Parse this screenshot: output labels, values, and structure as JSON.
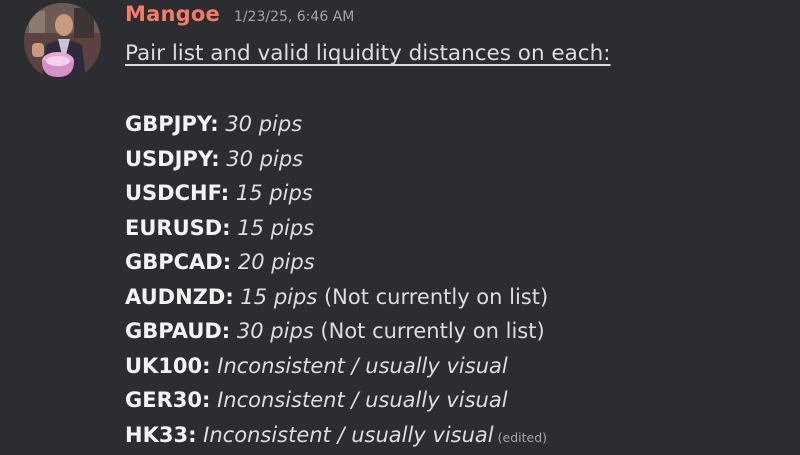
{
  "message": {
    "author": "Mangoe",
    "timestamp": "1/23/25, 6:46 AM",
    "intro": "Pair list and valid liquidity distances on each:",
    "edited_label": "(edited)",
    "rows": [
      {
        "pair": "GBPJPY:",
        "value": "30 pips",
        "note": ""
      },
      {
        "pair": "USDJPY:",
        "value": "30 pips",
        "note": ""
      },
      {
        "pair": "USDCHF:",
        "value": "15 pips",
        "note": ""
      },
      {
        "pair": "EURUSD:",
        "value": "15 pips",
        "note": ""
      },
      {
        "pair": "GBPCAD:",
        "value": "20 pips",
        "note": ""
      },
      {
        "pair": "AUDNZD:",
        "value": "15 pips",
        "note": "(Not currently on list)"
      },
      {
        "pair": "GBPAUD:",
        "value": "30 pips",
        "note": "(Not currently on list)"
      },
      {
        "pair": "UK100:",
        "value": "Inconsistent / usually visual",
        "note": ""
      },
      {
        "pair": "GER30:",
        "value": "Inconsistent / usually visual",
        "note": ""
      },
      {
        "pair": "HK33:",
        "value": "Inconsistent / usually visual",
        "note": ""
      }
    ]
  },
  "colors": {
    "background": "#2b2d31",
    "username": "#f47b67",
    "text": "#dbdee1",
    "muted": "#a3a6aa"
  }
}
